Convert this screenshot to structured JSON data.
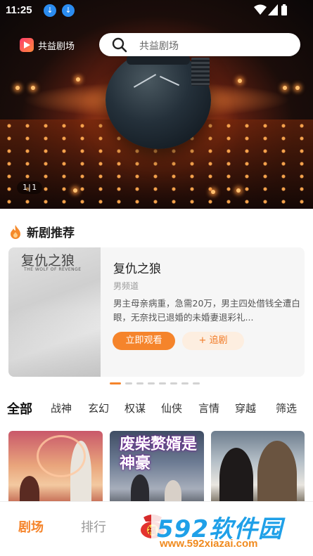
{
  "status_bar": {
    "time": "11:25"
  },
  "header": {
    "app_name": "共益剧场",
    "search_placeholder": "共益剧场"
  },
  "hero": {
    "indicator": "1|1"
  },
  "new_drama": {
    "title": "新剧推荐",
    "card": {
      "poster_title": "复仇之狼",
      "poster_subtitle": "THE WOLF OF REVENGE",
      "title": "复仇之狼",
      "channel": "男频道",
      "description": "男主母亲病重，急需20万，男主四处借钱全遭白眼，无奈找已退婚的未婚妻退彩礼...",
      "watch_label": "立即观看",
      "follow_label": "+ 追剧"
    },
    "page_count": 8,
    "active_page": 0
  },
  "categories": {
    "items": [
      "全部",
      "战神",
      "玄幻",
      "权谋",
      "仙侠",
      "言情",
      "穿越"
    ],
    "active": 0,
    "filter_label": "筛选"
  },
  "grid": {
    "items": [
      {
        "title": ""
      },
      {
        "title": "废柴赘婿是神豪"
      },
      {
        "title": ""
      }
    ]
  },
  "bottom_nav": {
    "home": "剧场",
    "rank": "排行",
    "welfare_badge": "福"
  },
  "watermark": {
    "main": "592软件园",
    "url": "www.592xiazai.com"
  },
  "colors": {
    "accent": "#f5842b",
    "accent_light": "#fdeee0"
  }
}
